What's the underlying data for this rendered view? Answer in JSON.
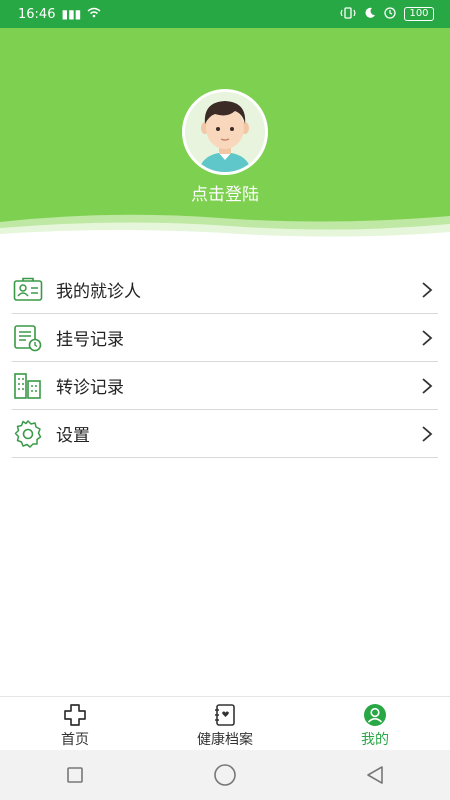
{
  "status_bar": {
    "time": "16:46",
    "signal": "▮▮▮",
    "wifi": "wifi",
    "battery": "100"
  },
  "profile": {
    "login_text": "点击登陆",
    "avatar_icon": "avatar-icon"
  },
  "menu": {
    "items": [
      {
        "label": "我的就诊人",
        "icon": "patient-card-icon"
      },
      {
        "label": "挂号记录",
        "icon": "registration-record-icon"
      },
      {
        "label": "转诊记录",
        "icon": "referral-building-icon"
      },
      {
        "label": "设置",
        "icon": "settings-gear-icon"
      }
    ]
  },
  "tabbar": {
    "tabs": [
      {
        "label": "首页",
        "icon": "home-cross-icon"
      },
      {
        "label": "健康档案",
        "icon": "health-record-icon"
      },
      {
        "label": "我的",
        "icon": "user-profile-icon",
        "active": true
      }
    ]
  },
  "colors": {
    "status_green": "#27a844",
    "header_green": "#7ed150",
    "accent_green": "#28a745",
    "icon_green": "#3a9a47"
  }
}
